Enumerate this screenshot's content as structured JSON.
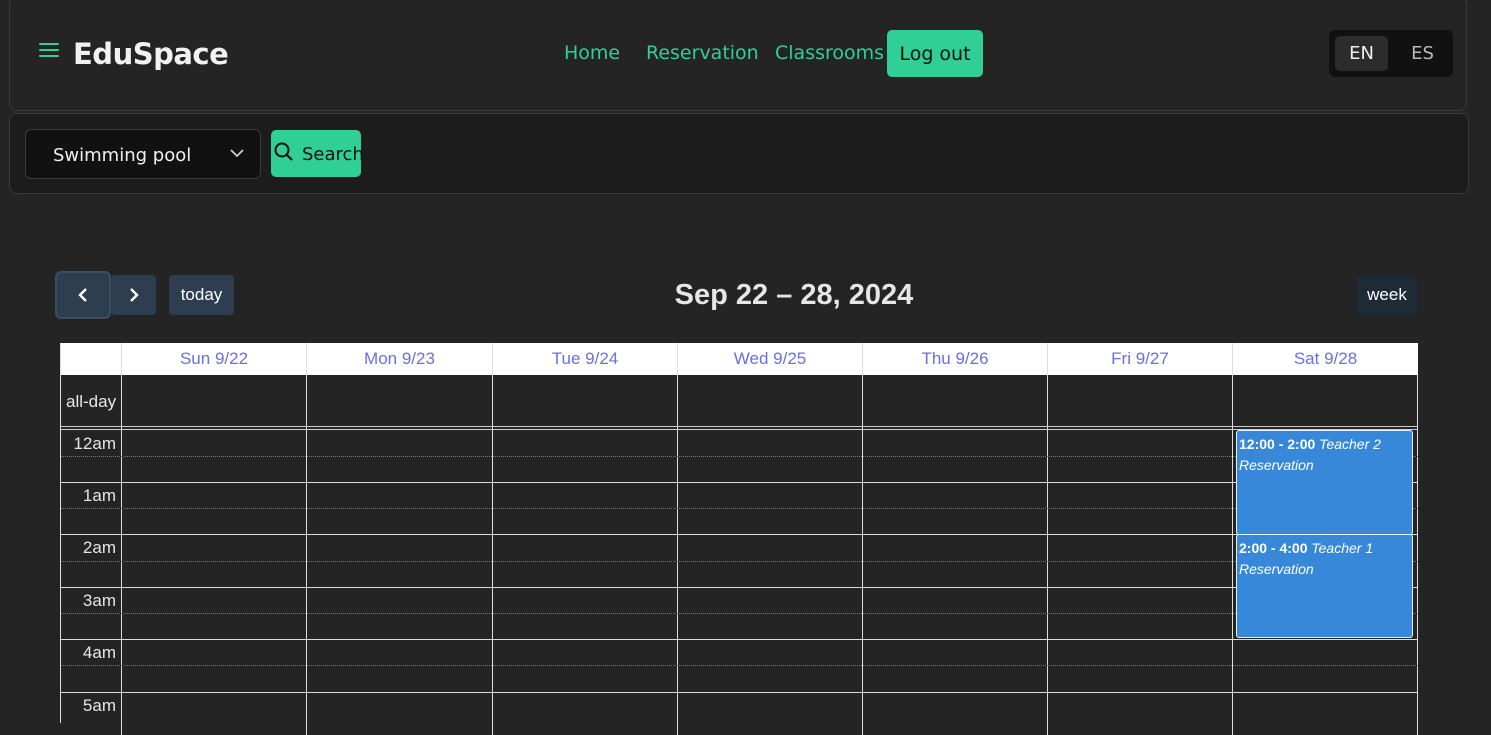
{
  "header": {
    "brand": "EduSpace",
    "nav": [
      "Home",
      "Reservation",
      "Classrooms"
    ],
    "logout_label": "Log out",
    "languages": [
      "EN",
      "ES"
    ],
    "active_language": "EN"
  },
  "filter": {
    "selected_room": "Swimming pool",
    "search_label": "Search"
  },
  "calendar": {
    "title": "Sep 22 – 28, 2024",
    "today_label": "today",
    "view_label": "week",
    "days": [
      "Sun 9/22",
      "Mon 9/23",
      "Tue 9/24",
      "Wed 9/25",
      "Thu 9/26",
      "Fri 9/27",
      "Sat 9/28"
    ],
    "allday_label": "all-day",
    "hours": [
      "12am",
      "1am",
      "2am",
      "3am",
      "4am",
      "5am"
    ],
    "events": [
      {
        "day": "Sat 9/28",
        "time": "12:00 - 2:00",
        "title": "Teacher 2 Reservation"
      },
      {
        "day": "Sat 9/28",
        "time": "2:00 - 4:00",
        "title": "Teacher 1 Reservation"
      }
    ]
  },
  "colors": {
    "accent": "#2fcf95",
    "background": "#242424",
    "event": "#3788d8",
    "day_header_text": "#6a6fe0"
  }
}
